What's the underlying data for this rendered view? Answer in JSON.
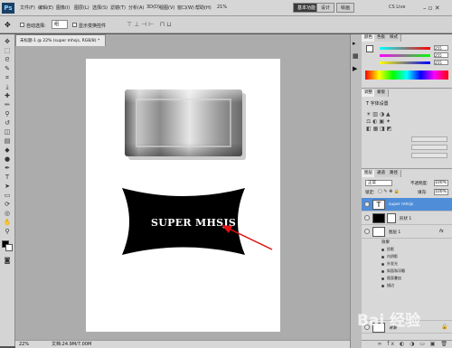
{
  "menubar": {
    "logo": "Ps",
    "items": [
      "文件(F)",
      "编辑(E)",
      "图像(I)",
      "图层(L)",
      "选择(S)",
      "滤镜(T)",
      "分析(A)",
      "3D(D)",
      "视图(V)",
      "窗口(W)",
      "帮助(H)"
    ],
    "zoom": "21%",
    "workspaces": [
      "基本功能",
      "设计",
      "绘画"
    ],
    "cslive": "CS Live"
  },
  "options": {
    "auto_select": "自动选择:",
    "auto_select_value": "组",
    "show_transform": "显示变换控件"
  },
  "document": {
    "tab": "未标题-1 @ 22% (super mhsjs, RGB/8) *",
    "canvas_text": "SUPER MHSJS"
  },
  "status": {
    "zoom": "22%",
    "doc": "文档:24.9M/7.00M"
  },
  "panels": {
    "color_tab": "颜色",
    "swatch_tab": "色板",
    "style_tab": "样式",
    "r": "255",
    "g": "255",
    "b": "255",
    "char_title": "T 字体设置",
    "adjust_tabs": [
      "调整",
      "蒙版"
    ],
    "layers_tab": "图层",
    "channels_tab": "通道",
    "paths_tab": "路径",
    "blend_mode": "正常",
    "opacity_label": "不透明度:",
    "opacity": "100%",
    "lock_label": "锁定:",
    "fill_label": "填充:",
    "fill": "100%",
    "layers": [
      {
        "name": "super mhsjs",
        "type": "text"
      },
      {
        "name": "形状 1",
        "type": "shape"
      },
      {
        "name": "图层 1",
        "type": "pixel",
        "fx": "fx"
      },
      {
        "name": "背景",
        "type": "bg"
      }
    ],
    "effects_title": "效果",
    "effects": [
      "投影",
      "内阴影",
      "外发光",
      "斜面和浮雕",
      "图案叠加",
      "描边"
    ]
  },
  "watermark": "Bai 经验"
}
